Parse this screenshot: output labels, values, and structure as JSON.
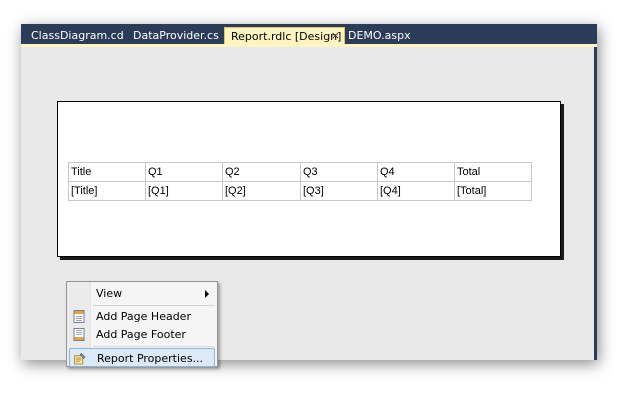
{
  "tabs": [
    {
      "label": "ClassDiagram.cd",
      "active": false
    },
    {
      "label": "DataProvider.cs",
      "active": false
    },
    {
      "label": "Report.rdlc [Design]",
      "active": true,
      "close_glyph": "×"
    },
    {
      "label": "DEMO.aspx",
      "active": false
    }
  ],
  "tablix": {
    "header": [
      "Title",
      "Q1",
      "Q2",
      "Q3",
      "Q4",
      "Total"
    ],
    "detail": [
      "[Title]",
      "[Q1]",
      "[Q2]",
      "[Q3]",
      "[Q4]",
      "[Total]"
    ]
  },
  "context_menu": {
    "items": [
      {
        "label": "View",
        "icon": "",
        "has_submenu": true
      },
      {
        "label": "Add Page Header",
        "icon": "page-header-icon"
      },
      {
        "label": "Add Page Footer",
        "icon": "page-footer-icon"
      },
      {
        "label": "Report Properties...",
        "icon": "report-properties-icon",
        "highlighted": true
      }
    ]
  },
  "colors": {
    "tab_strip": "#2b3c59",
    "active_tab": "#fdf4bf",
    "menu_highlight": "#dce9f7"
  }
}
